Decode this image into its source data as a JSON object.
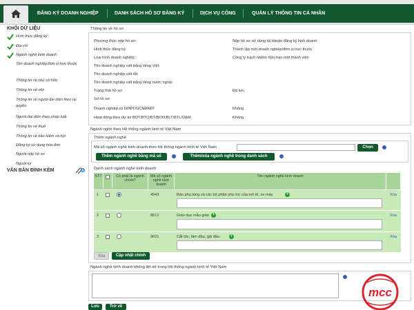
{
  "nav": {
    "items": [
      "ĐĂNG KÝ DOANH NGHIỆP",
      "DANH SÁCH HỒ SƠ ĐĂNG KÝ",
      "DỊCH VỤ CÔNG",
      "QUẢN LÝ THÔNG TIN CÁ NHÂN"
    ]
  },
  "sidebar": {
    "title": "KHỐI DỮ LIỆU",
    "checked_items": [
      "Hình thức đăng ký",
      "Địa chỉ",
      "Ngành nghề kinh doanh"
    ],
    "items": [
      "Tên doanh nghiệp/đơn vị trực thuộc",
      "Thông tin về chủ sở hữu",
      "Thông tin về vốn",
      "Thông tin về người đại diện theo ủy quyền",
      "Người đại diện theo pháp luật",
      "Thông tin về thuế",
      "Thông tin về bảo hiểm xã hội",
      "Đăng ký sử dụng hóa đơn",
      "Người nộp hồ sơ",
      "Người ký"
    ],
    "attach_title": "VĂN BẢN ĐÍNH KÈM"
  },
  "profile": {
    "title": "Thông tin về hồ sơ",
    "rows": [
      {
        "label": "Phương thức nộp hồ sơ:",
        "value": "Nộp hồ sơ sử dụng tài khoản đăng ký kinh doanh"
      },
      {
        "label": "Hình thức đăng ký:",
        "value": "Thành lập mới doanh nghiệp/đơn vị trực thuộc"
      },
      {
        "label": "Loại hình doanh nghiệp:",
        "value": "Công ty trách nhiệm hữu hạn một thành viên"
      },
      {
        "label": "Tên doanh nghiệp viết bằng tiếng Việt:",
        "value": ""
      },
      {
        "label": "Tên doanh nghiệp viết tắt:",
        "value": ""
      },
      {
        "label": "Tên doanh nghiệp viết bằng tiếng nước ngoài:",
        "value": ""
      },
      {
        "label": "Trạng thái hồ sơ:",
        "value": "Đã lưu"
      },
      {
        "label": "Số hồ sơ:",
        "value": ""
      },
      {
        "label": "Doanh nghiệp có GPĐT/GCNĐKĐT",
        "value": "Không"
      },
      {
        "label": "Hoạt động theo dự án BOT/BTO/BT/BOO/BLT/BTL/O&M",
        "value": "Không"
      }
    ]
  },
  "industry": {
    "section_title": "Ngành nghề theo Hệ thống ngành kinh tế Việt Nam",
    "add_title": "Thêm ngành nghề",
    "code_label": "Mã số ngành nghề kinh doanh theo Hệ thống ngành kinh tế Việt Nam",
    "code_value": "",
    "choose_button": "Chọn",
    "add_by_code_button": "Thêm ngành nghề bằng mã số",
    "add_from_list_button": "Thêm/xóa ngành nghề trong danh sách",
    "list_title": "Danh sách ngành nghề kinh doanh",
    "headers": [
      "STT",
      "",
      "Có phải là ngành chính?",
      "Mã số ngành nghề kinh doanh",
      "Tên ngành nghề kinh doanh",
      ""
    ],
    "rows": [
      {
        "stt": "1",
        "main": true,
        "code": "4543",
        "name": "Bán phụ tùng và các bộ phận phụ trợ của mô tô, xe máy",
        "delete": "Xóa"
      },
      {
        "stt": "2",
        "main": false,
        "code": "8512",
        "name": "Giáo dục mẫu giáo",
        "delete": "Xóa"
      },
      {
        "stt": "3",
        "main": false,
        "code": "9631",
        "name": "Cắt tóc, làm đầu, gội đầu",
        "delete": "Xóa"
      }
    ],
    "delete_button": "Xóa",
    "update_main_button": "Cập nhật chính"
  },
  "other_industry": {
    "title": "Ngành nghề kinh doanh không liệt kê trong Hệ thống ngành kinh tế Việt Nam"
  },
  "footer": {
    "save_button": "Lưu",
    "back_button": "Trở về"
  },
  "logo": {
    "text": "mcc"
  },
  "colors": {
    "nav_green": "#12572f",
    "row_green": "#c8eab8",
    "header_green": "#a9d59a",
    "logo_red": "#d9232d"
  }
}
